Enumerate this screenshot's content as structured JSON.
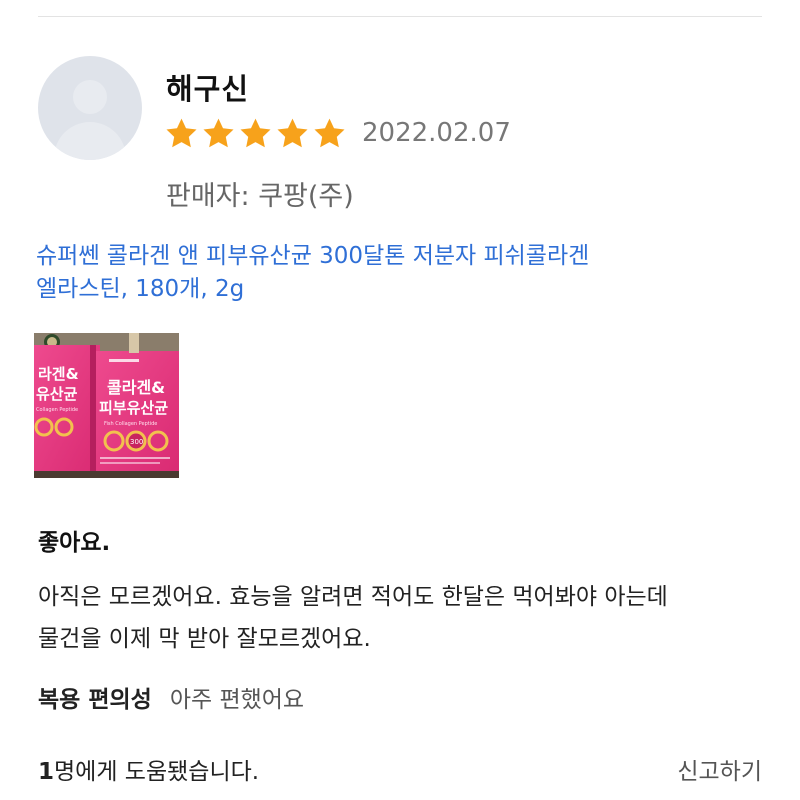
{
  "reviewer": {
    "name": "해구신",
    "rating": 5,
    "rating_max": 5,
    "date": "2022.02.07",
    "seller": "판매자: 쿠팡(주)"
  },
  "product": {
    "line1": "슈퍼쎈 콜라겐 앤 피부유산균 300달톤 저분자 피쉬콜라겐",
    "line2": "엘라스틴, 180개, 2g"
  },
  "photo": {
    "box_text_line1": "콜라겐&",
    "box_text_line2": "피부유산균",
    "box_subtext": "Fish Collagen Peptide",
    "left_box_line1": "라겐&",
    "left_box_line2": "유산균",
    "left_box_subtext": "Collagen Peptide",
    "badge_text": "300"
  },
  "review": {
    "headline": "좋아요.",
    "body_line1": "아직은 모르겠어요. 효능을 알려면 적어도 한달은 먹어봐야 아는데",
    "body_line2": "물건을 이제 막 받아 잘모르겠어요."
  },
  "attribute": {
    "label": "복용 편의성",
    "value": "아주 편했어요"
  },
  "footer": {
    "helpful_count": "1",
    "helpful_suffix": "명에게 도움됐습니다.",
    "report_label": "신고하기"
  },
  "colors": {
    "star": "#f7a21b",
    "link": "#2f6fd6",
    "date": "#777777",
    "box_pink": "#e8347c"
  },
  "icons": {
    "avatar": "default-user-avatar-icon",
    "star": "filled-star-icon"
  }
}
